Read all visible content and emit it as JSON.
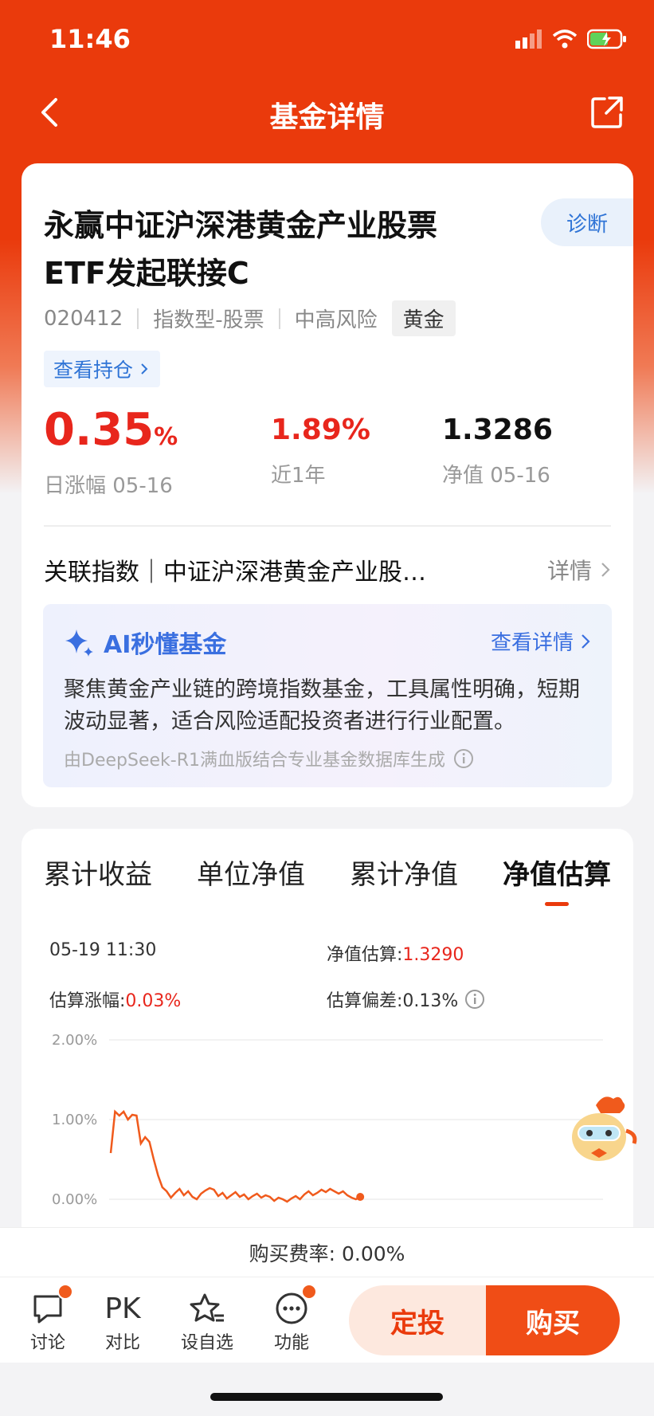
{
  "status_bar": {
    "time": "11:46"
  },
  "nav": {
    "title": "基金详情"
  },
  "fund": {
    "name_line1": "永赢中证沪深港黄金产业股票",
    "name_line2": "ETF发起联接C",
    "diagnose": "诊断",
    "code": "020412",
    "type": "指数型-股票",
    "risk": "中高风险",
    "tag": "黄金",
    "holdings_link": "查看持仓"
  },
  "stats": {
    "daily_value": "0.35",
    "daily_unit": "%",
    "daily_label": "日涨幅 05-16",
    "year_value": "1.89%",
    "year_label": "近1年",
    "nav_value": "1.3286",
    "nav_label": "净值 05-16"
  },
  "index_row": {
    "text": "关联指数｜中证沪深港黄金产业股…",
    "detail": "详情"
  },
  "ai": {
    "title": "AI秒懂基金",
    "detail": "查看详情",
    "description": "聚焦黄金产业链的跨境指数基金，工具属性明确，短期波动显著，适合风险适配投资者进行行业配置。",
    "footer": "由DeepSeek-R1满血版结合专业基金数据库生成"
  },
  "tabs": [
    "累计收益",
    "单位净值",
    "累计净值",
    "净值估算"
  ],
  "active_tab": 3,
  "estimate": {
    "time": "05-19 11:30",
    "est_label": "净值估算:",
    "est_value": "1.3290",
    "change_label": "估算涨幅:",
    "change_value": "0.03%",
    "deviation_label": "估算偏差:",
    "deviation_value": "0.13%"
  },
  "chart_data": {
    "type": "line",
    "y_ticks": [
      "2.00%",
      "1.00%",
      "0.00%"
    ],
    "ylim": [
      -0.1,
      2.0
    ],
    "color": "#f05a1c",
    "series": [
      {
        "values": [
          0.58,
          1.1,
          1.05,
          1.1,
          1.0,
          1.06,
          1.05,
          0.7,
          0.78,
          0.72,
          0.5,
          0.3,
          0.15,
          0.1,
          0.02,
          0.08,
          0.13,
          0.05,
          0.1,
          0.03,
          0.0,
          0.07,
          0.11,
          0.14,
          0.12,
          0.04,
          0.08,
          0.01,
          0.05,
          0.09,
          0.03,
          0.06,
          0.0,
          0.04,
          0.07,
          0.02,
          0.05,
          0.03,
          -0.02,
          0.02,
          0.0,
          -0.03,
          0.01,
          0.04,
          0.0,
          0.06,
          0.1,
          0.05,
          0.08,
          0.12,
          0.09,
          0.13,
          0.1,
          0.07,
          0.1,
          0.05,
          0.02,
          0.0,
          0.03
        ]
      }
    ]
  },
  "fee": "购买费率: 0.00%",
  "bottom": {
    "discuss": "讨论",
    "pk": "PK",
    "compare": "对比",
    "watch": "设自选",
    "functions": "功能",
    "auto_invest": "定投",
    "buy": "购买"
  }
}
